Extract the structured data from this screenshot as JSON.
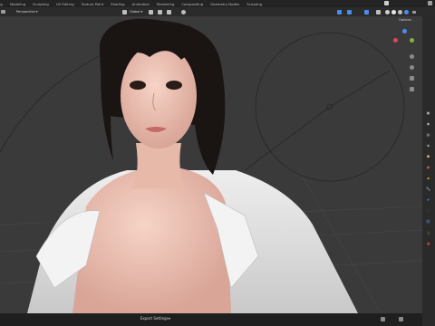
{
  "workspace_tabs": [
    "ng",
    "Modeling",
    "Sculpting",
    "UV Editing",
    "Texture Paint",
    "Shading",
    "Animation",
    "Rendering",
    "Compositing",
    "Geometry Nodes",
    "Scripting"
  ],
  "header": {
    "view_mode": "Perspective",
    "transform_orientation": "Global"
  },
  "viewport_overlay": {
    "options_label": "Options",
    "gizmo_axes": [
      "X",
      "Y",
      "Z"
    ]
  },
  "status_bar": {
    "label": "Export Settings"
  },
  "colors": {
    "accent_blue": "#4a8df0",
    "axis_x": "#e0474f",
    "axis_y": "#7eb33c",
    "axis_z": "#4a8df0",
    "viewport_bg": "#3a3a3a"
  }
}
